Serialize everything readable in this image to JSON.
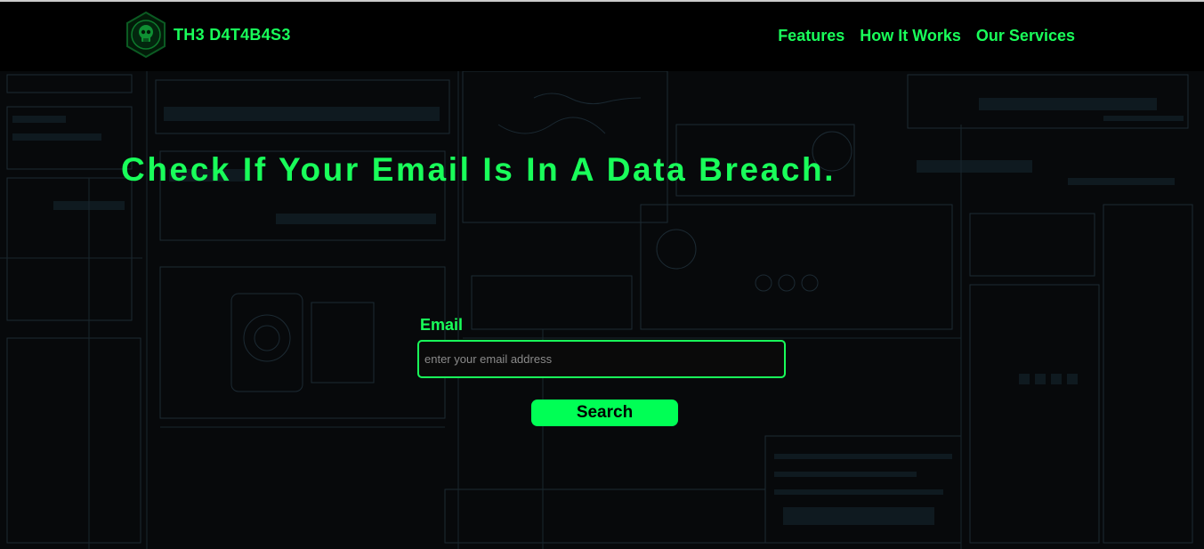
{
  "header": {
    "brand_name": "TH3 D4T4B4S3",
    "logo_icon": "skull-emblem-icon",
    "nav": [
      {
        "label": "Features"
      },
      {
        "label": "How It Works"
      },
      {
        "label": "Our Services"
      }
    ]
  },
  "hero": {
    "title": "Check If Your Email Is In A Data Breach."
  },
  "form": {
    "email_label": "Email",
    "email_placeholder": "enter your email address",
    "email_value": "",
    "search_label": "Search"
  },
  "colors": {
    "accent": "#19ff5a",
    "button": "#00ff55",
    "background": "#000000"
  }
}
